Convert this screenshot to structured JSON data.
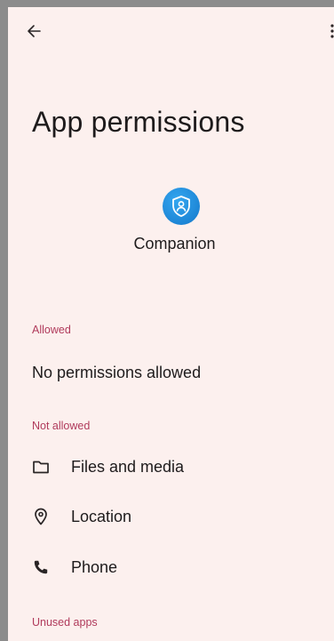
{
  "header": {
    "title": "App permissions"
  },
  "app": {
    "name": "Companion",
    "icon": "shield-person-icon",
    "icon_color": "#1d86d6"
  },
  "sections": {
    "allowed": {
      "header": "Allowed",
      "empty_text": "No permissions allowed"
    },
    "not_allowed": {
      "header": "Not allowed",
      "items": [
        {
          "label": "Files and media",
          "icon": "folder-icon"
        },
        {
          "label": "Location",
          "icon": "location-pin-icon"
        },
        {
          "label": "Phone",
          "icon": "phone-icon"
        }
      ]
    },
    "unused": {
      "header": "Unused apps"
    }
  },
  "colors": {
    "background": "#fcf0ee",
    "section_header": "#b03a5b",
    "text": "#1e1b1c"
  }
}
